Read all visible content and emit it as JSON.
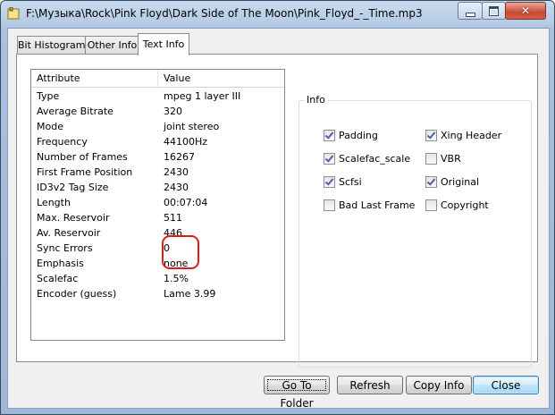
{
  "window": {
    "title": "F:\\Музыка\\Rock\\Pink Floyd\\Dark Side of The Moon\\Pink_Floyd_-_Time.mp3",
    "close_glyph": "✕"
  },
  "tabs": [
    {
      "label": "Bit Histogram",
      "active": false
    },
    {
      "label": "Other Info",
      "active": false
    },
    {
      "label": "Text Info",
      "active": true
    }
  ],
  "table": {
    "columns": [
      "Attribute",
      "Value"
    ],
    "rows": [
      [
        "Type",
        "mpeg 1 layer III"
      ],
      [
        "Average Bitrate",
        "320"
      ],
      [
        "Mode",
        "joint stereo"
      ],
      [
        "Frequency",
        "44100Hz"
      ],
      [
        "Number of Frames",
        "16267"
      ],
      [
        "First Frame Position",
        "2430"
      ],
      [
        "ID3v2 Tag Size",
        "2430"
      ],
      [
        "Length",
        "00:07:04"
      ],
      [
        "Max. Reservoir",
        "511"
      ],
      [
        "Av. Reservoir",
        "446"
      ],
      [
        "Sync Errors",
        "0"
      ],
      [
        "Emphasis",
        "none"
      ],
      [
        "Scalefac",
        "1.5%"
      ],
      [
        "Encoder (guess)",
        "Lame 3.99"
      ]
    ]
  },
  "info_group": {
    "legend": "Info",
    "checkboxes": [
      {
        "label": "Padding",
        "checked": true
      },
      {
        "label": "Xing Header",
        "checked": true
      },
      {
        "label": "Scalefac_scale",
        "checked": true
      },
      {
        "label": "VBR",
        "checked": false
      },
      {
        "label": "Scfsi",
        "checked": true
      },
      {
        "label": "Original",
        "checked": true
      },
      {
        "label": "Bad Last Frame",
        "checked": false
      },
      {
        "label": "Copyright",
        "checked": false
      }
    ]
  },
  "buttons": {
    "go_to_folder": "Go To Folder",
    "refresh": "Refresh",
    "copy_info": "Copy Info",
    "close": "Close"
  },
  "colors": {
    "highlight_annotation": "#e01b1b",
    "checkmark": "#4c61a5"
  }
}
